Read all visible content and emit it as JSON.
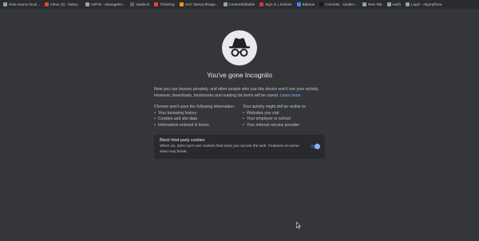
{
  "bookmarks_bar": {
    "items": [
      {
        "label": "view-source:local...",
        "icon": "globe-icon",
        "color": "#9aa0a6"
      },
      {
        "label": "Inbox (3) - tiwsqi...",
        "icon": "gmail-icon",
        "color": "#ea4335"
      },
      {
        "label": "ADFIS - ManageEn...",
        "icon": "adfis-icon",
        "color": "#9aa0a6"
      },
      {
        "label": "saaltech",
        "icon": "folder-icon",
        "color": "#5f6368"
      },
      {
        "label": "Ticketing",
        "icon": "ticketing-icon",
        "color": "#ea4335"
      },
      {
        "label": "UAC Manoj Bhaga...",
        "icon": "uac-icon",
        "color": "#f29900"
      },
      {
        "label": "ContentEditable",
        "icon": "contenteditable-icon",
        "color": "#9aa0a6"
      },
      {
        "label": "Sign in | Jenkins",
        "icon": "jenkins-icon",
        "color": "#d33833"
      },
      {
        "label": "Bitbarie",
        "icon": "bitbucket-icon",
        "color": "#4285f4"
      },
      {
        "label": "Commits · saaltec...",
        "icon": "github-icon",
        "color": "#1a1a1a"
      },
      {
        "label": "New Tab",
        "icon": "new-tab-icon",
        "color": "#9aa0a6"
      },
      {
        "label": "earth",
        "icon": "earth-icon",
        "color": "#9aa0a6"
      },
      {
        "label": "Login - Algorythma",
        "icon": "algorythma-icon",
        "color": "#9aa0a6"
      }
    ]
  },
  "incognito": {
    "icon": "incognito-spy-icon",
    "title": "You've gone Incognito",
    "intro_line1": "Now you can browse privately, and other people who use this device won't see your activity.",
    "intro_line2": "However, downloads, bookmarks and reading list items will be saved.",
    "learn_more": "Learn more",
    "not_saved": {
      "heading": "Chrome won't save the following information:",
      "items": [
        "Your browsing history",
        "Cookies and site data",
        "Information entered in forms"
      ]
    },
    "visible_to": {
      "heading": "Your activity might still be visible to:",
      "items": [
        "Websites you visit",
        "Your employer or school",
        "Your internet service provider"
      ]
    },
    "cookies": {
      "title": "Block third-party cookies",
      "description": "When on, sites can't use cookies that track you across the web. Features on some sites may break.",
      "toggle_on": true
    }
  },
  "colors": {
    "background": "#35363a",
    "link": "#8ab4f8",
    "toggle": "#8ab4f8"
  }
}
